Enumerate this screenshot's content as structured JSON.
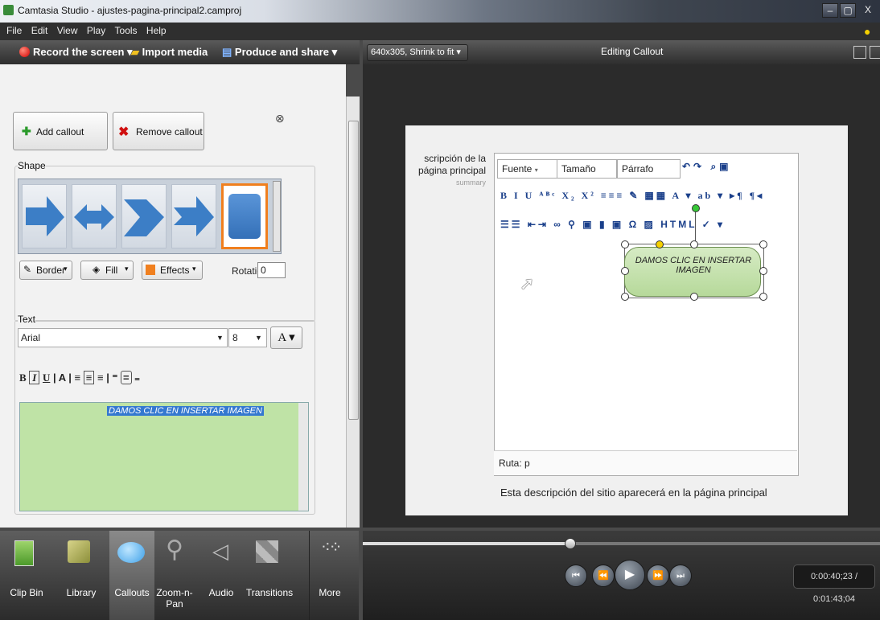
{
  "window": {
    "title": "Camtasia Studio - ajustes-pagina-principal2.camproj",
    "controls": [
      "–",
      "▢",
      "X"
    ]
  },
  "menu": [
    "File",
    "Edit",
    "View",
    "Play",
    "Tools",
    "Help"
  ],
  "toolbar": {
    "record": "Record the screen ▾",
    "import": "Import media",
    "produce": "Produce and share ▾",
    "size_select": "640x305, Shrink to fit",
    "editing_label": "Editing Callout"
  },
  "callout_panel": {
    "add_label": "Add callout",
    "remove_label": "Remove callout",
    "shape_label": "Shape",
    "border_label": "Border",
    "fill_label": "Fill",
    "effects_label": "Effects",
    "rotation_label": "Rotation:",
    "rotation_value": "0",
    "text_label": "Text",
    "font": "Arial",
    "font_size": "8",
    "text_content": "DAMOS CLIC EN INSERTAR IMAGEN"
  },
  "bottom_tools": [
    {
      "label": "Clip Bin",
      "icon": "clip-bin-icon"
    },
    {
      "label": "Library",
      "icon": "library-icon"
    },
    {
      "label": "Callouts",
      "icon": "callouts-icon"
    },
    {
      "label": "Zoom-n-Pan",
      "icon": "zoom-icon"
    },
    {
      "label": "Audio",
      "icon": "audio-icon"
    },
    {
      "label": "Transitions",
      "icon": "transitions-icon"
    },
    {
      "label": "More",
      "icon": "more-icon"
    }
  ],
  "preview": {
    "field_label": "scripción de la página principal",
    "field_hint": "summary",
    "font_select": "Fuente",
    "size_select": "Tamaño",
    "para_select": "Párrafo",
    "path": "Ruta: p",
    "callout_text": "DAMOS CLIC EN INSERTAR IMAGEN",
    "description": "Esta descripción del sitio aparecerá en la página principal"
  },
  "timeline": {
    "time": "0:00:40;23 / 0:01:43;04",
    "progress": 0.4
  }
}
